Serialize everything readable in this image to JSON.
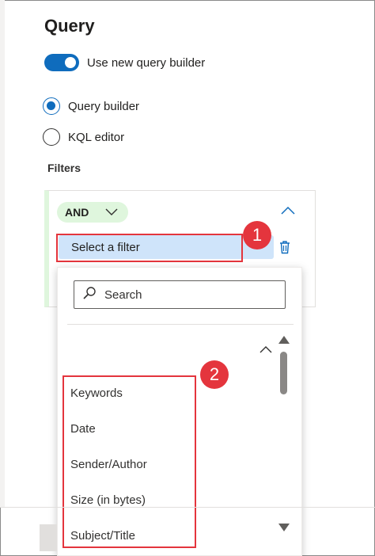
{
  "header": {
    "title": "Query"
  },
  "toggle": {
    "label": "Use new query builder",
    "on": true
  },
  "mode": {
    "options": [
      {
        "label": "Query builder",
        "selected": true
      },
      {
        "label": "KQL editor",
        "selected": false
      }
    ]
  },
  "filters": {
    "label": "Filters",
    "operator": "AND",
    "select_label": "Select a filter"
  },
  "dropdown": {
    "search_placeholder": "Search",
    "items": [
      {
        "label": "Keywords"
      },
      {
        "label": "Date"
      },
      {
        "label": "Sender/Author"
      },
      {
        "label": "Size (in bytes)"
      },
      {
        "label": "Subject/Title"
      }
    ]
  },
  "callouts": {
    "one": "1",
    "two": "2"
  },
  "colors": {
    "accent": "#0f6cbd",
    "callout": "#e4353d",
    "pill": "#dff6dd",
    "select_bg": "#cfe4fa"
  }
}
